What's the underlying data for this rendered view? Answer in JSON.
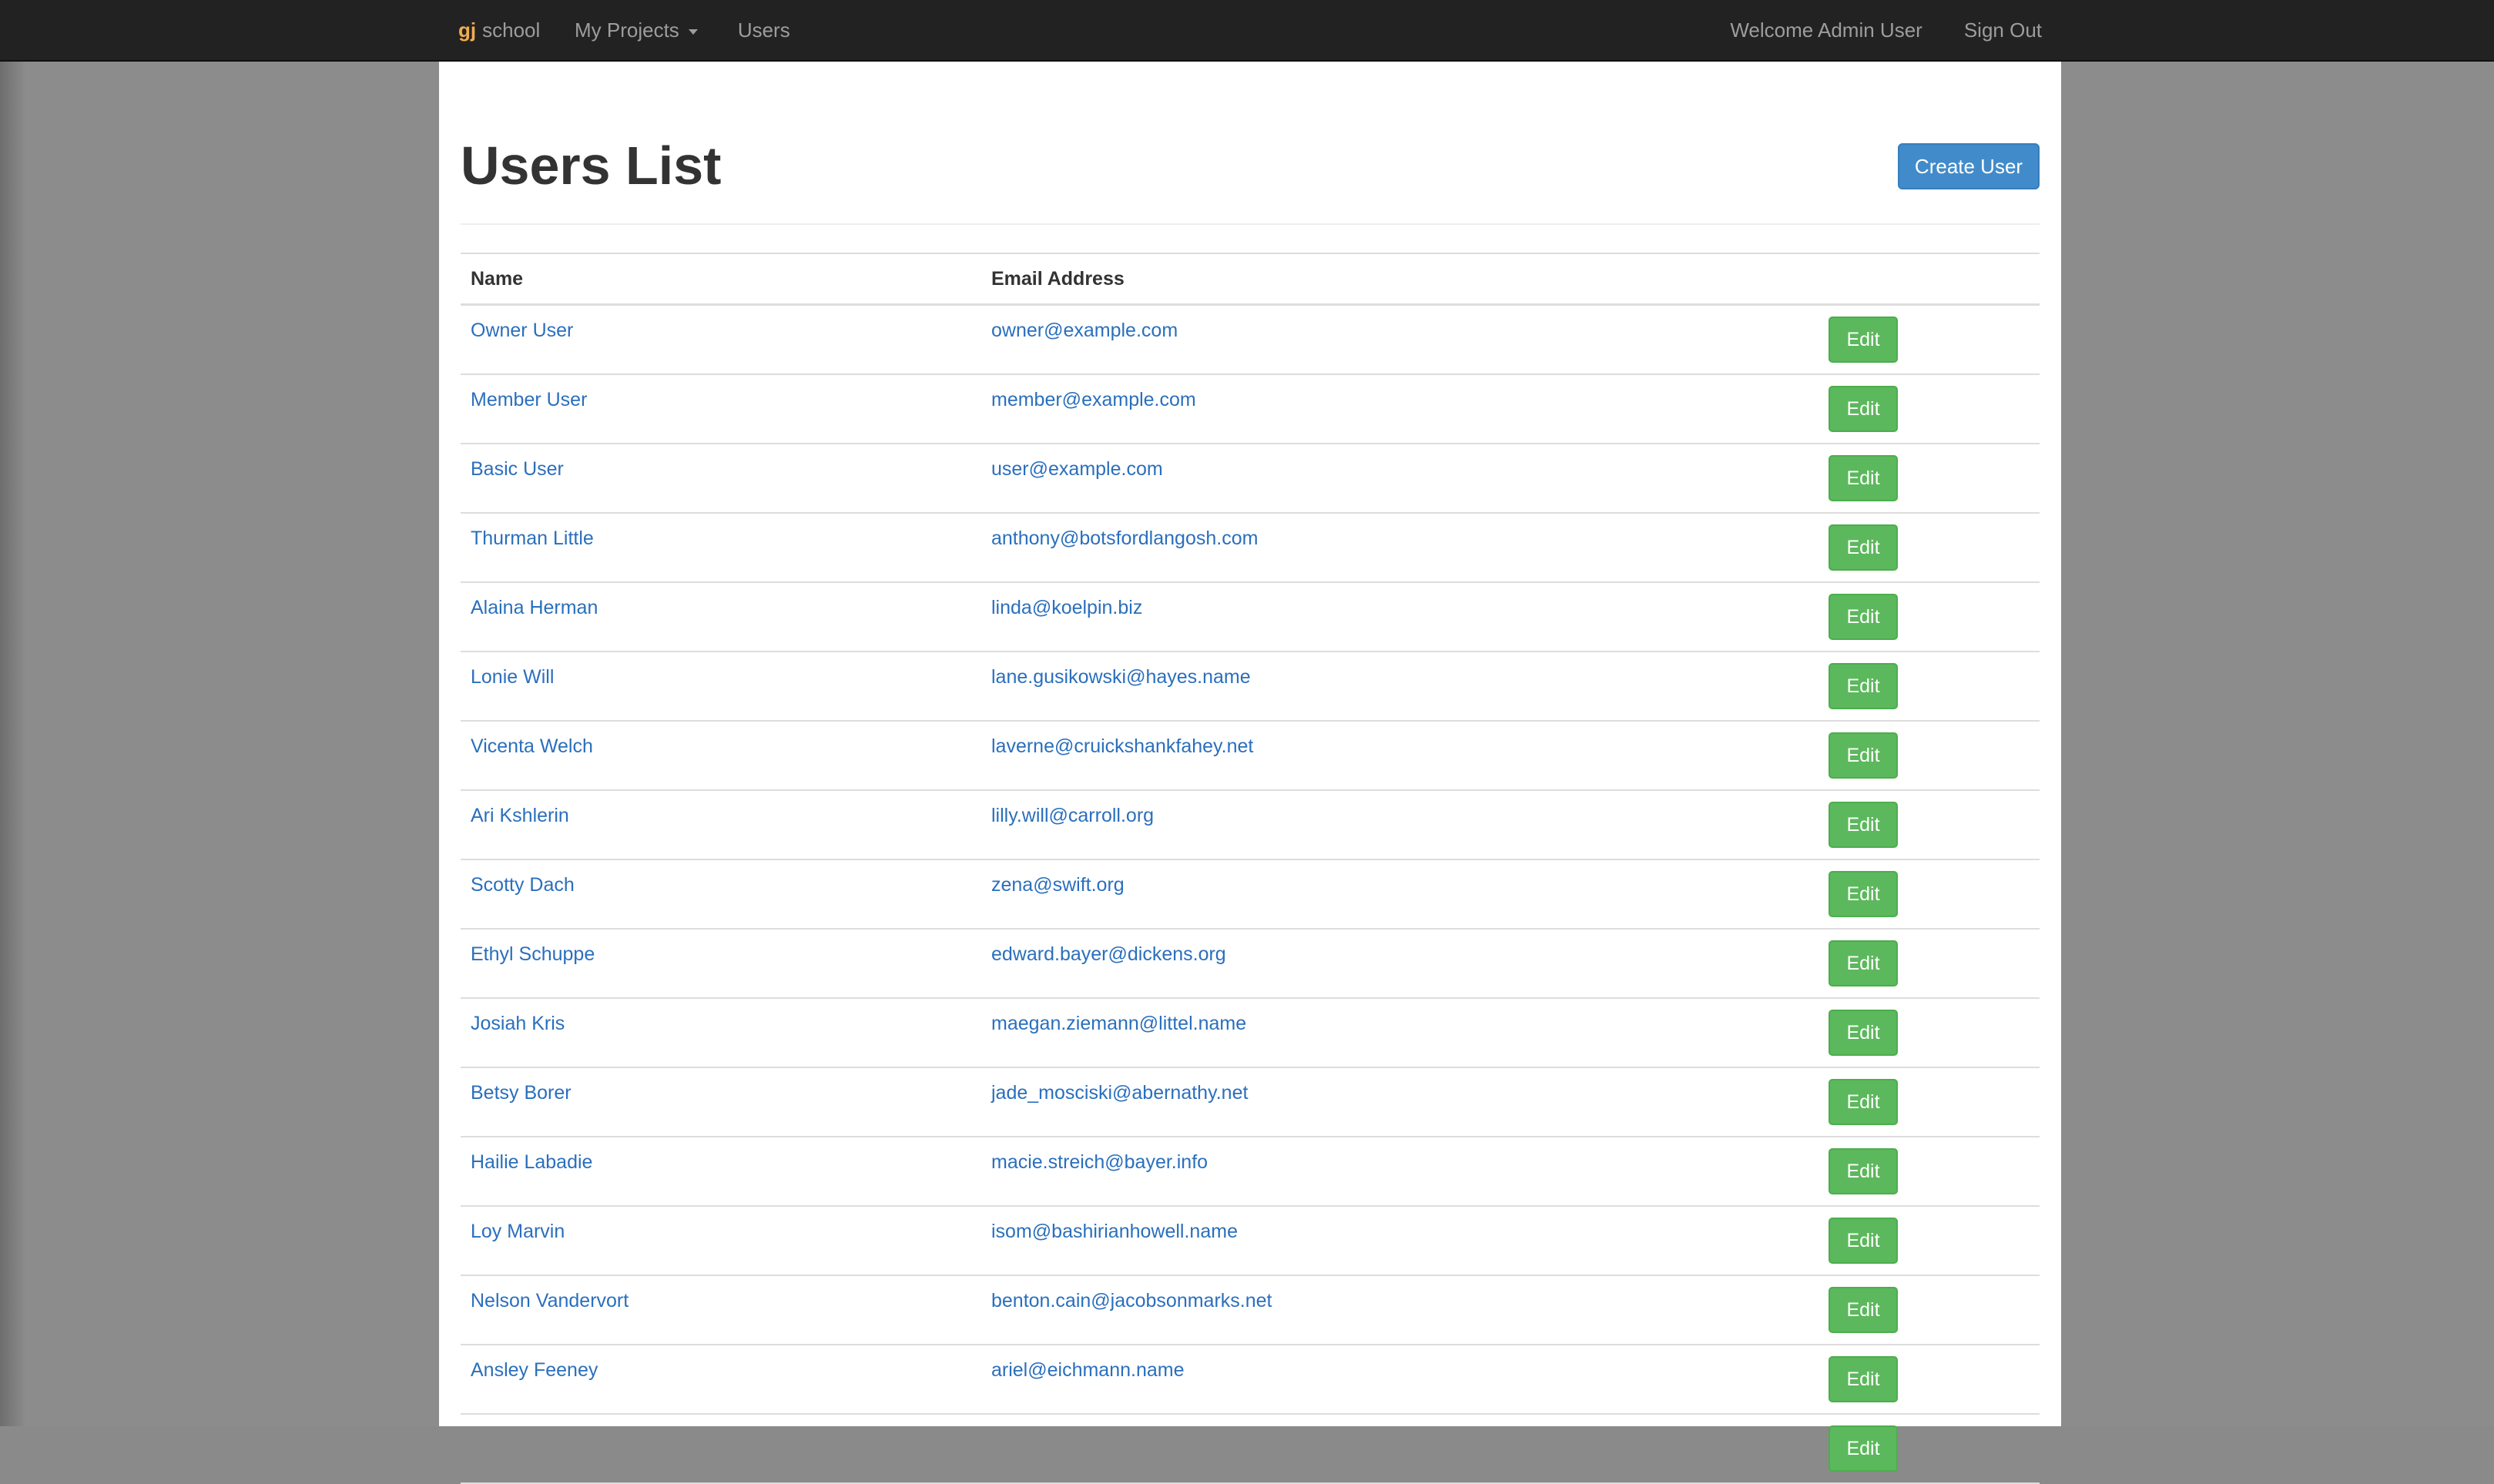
{
  "navbar": {
    "brand_icon": "gj",
    "brand_text": "school",
    "my_projects": "My Projects",
    "users": "Users",
    "welcome": "Welcome Admin User",
    "sign_out": "Sign Out"
  },
  "page": {
    "title": "Users List",
    "create_button": "Create User"
  },
  "table": {
    "headers": {
      "name": "Name",
      "email": "Email Address"
    },
    "edit_label": "Edit",
    "rows": [
      {
        "name": "Owner User",
        "email": "owner@example.com"
      },
      {
        "name": "Member User",
        "email": "member@example.com"
      },
      {
        "name": "Basic User",
        "email": "user@example.com"
      },
      {
        "name": "Thurman Little",
        "email": "anthony@botsfordlangosh.com"
      },
      {
        "name": "Alaina Herman",
        "email": "linda@koelpin.biz"
      },
      {
        "name": "Lonie Will",
        "email": "lane.gusikowski@hayes.name"
      },
      {
        "name": "Vicenta Welch",
        "email": "laverne@cruickshankfahey.net"
      },
      {
        "name": "Ari Kshlerin",
        "email": "lilly.will@carroll.org"
      },
      {
        "name": "Scotty Dach",
        "email": "zena@swift.org"
      },
      {
        "name": "Ethyl Schuppe",
        "email": "edward.bayer@dickens.org"
      },
      {
        "name": "Josiah Kris",
        "email": "maegan.ziemann@littel.name"
      },
      {
        "name": "Betsy Borer",
        "email": "jade_mosciski@abernathy.net"
      },
      {
        "name": "Hailie Labadie",
        "email": "macie.streich@bayer.info"
      },
      {
        "name": "Loy Marvin",
        "email": "isom@bashirianhowell.name"
      },
      {
        "name": "Nelson Vandervort",
        "email": "benton.cain@jacobsonmarks.net"
      },
      {
        "name": "Ansley Feeney",
        "email": "ariel@eichmann.name"
      },
      {
        "name": "",
        "email": ""
      }
    ]
  },
  "colors": {
    "navbar_bg": "#222222",
    "link": "#2a6fbd",
    "primary_button": "#428bca",
    "edit_button": "#5cb85c",
    "brand_icon": "#f0ad4e"
  }
}
